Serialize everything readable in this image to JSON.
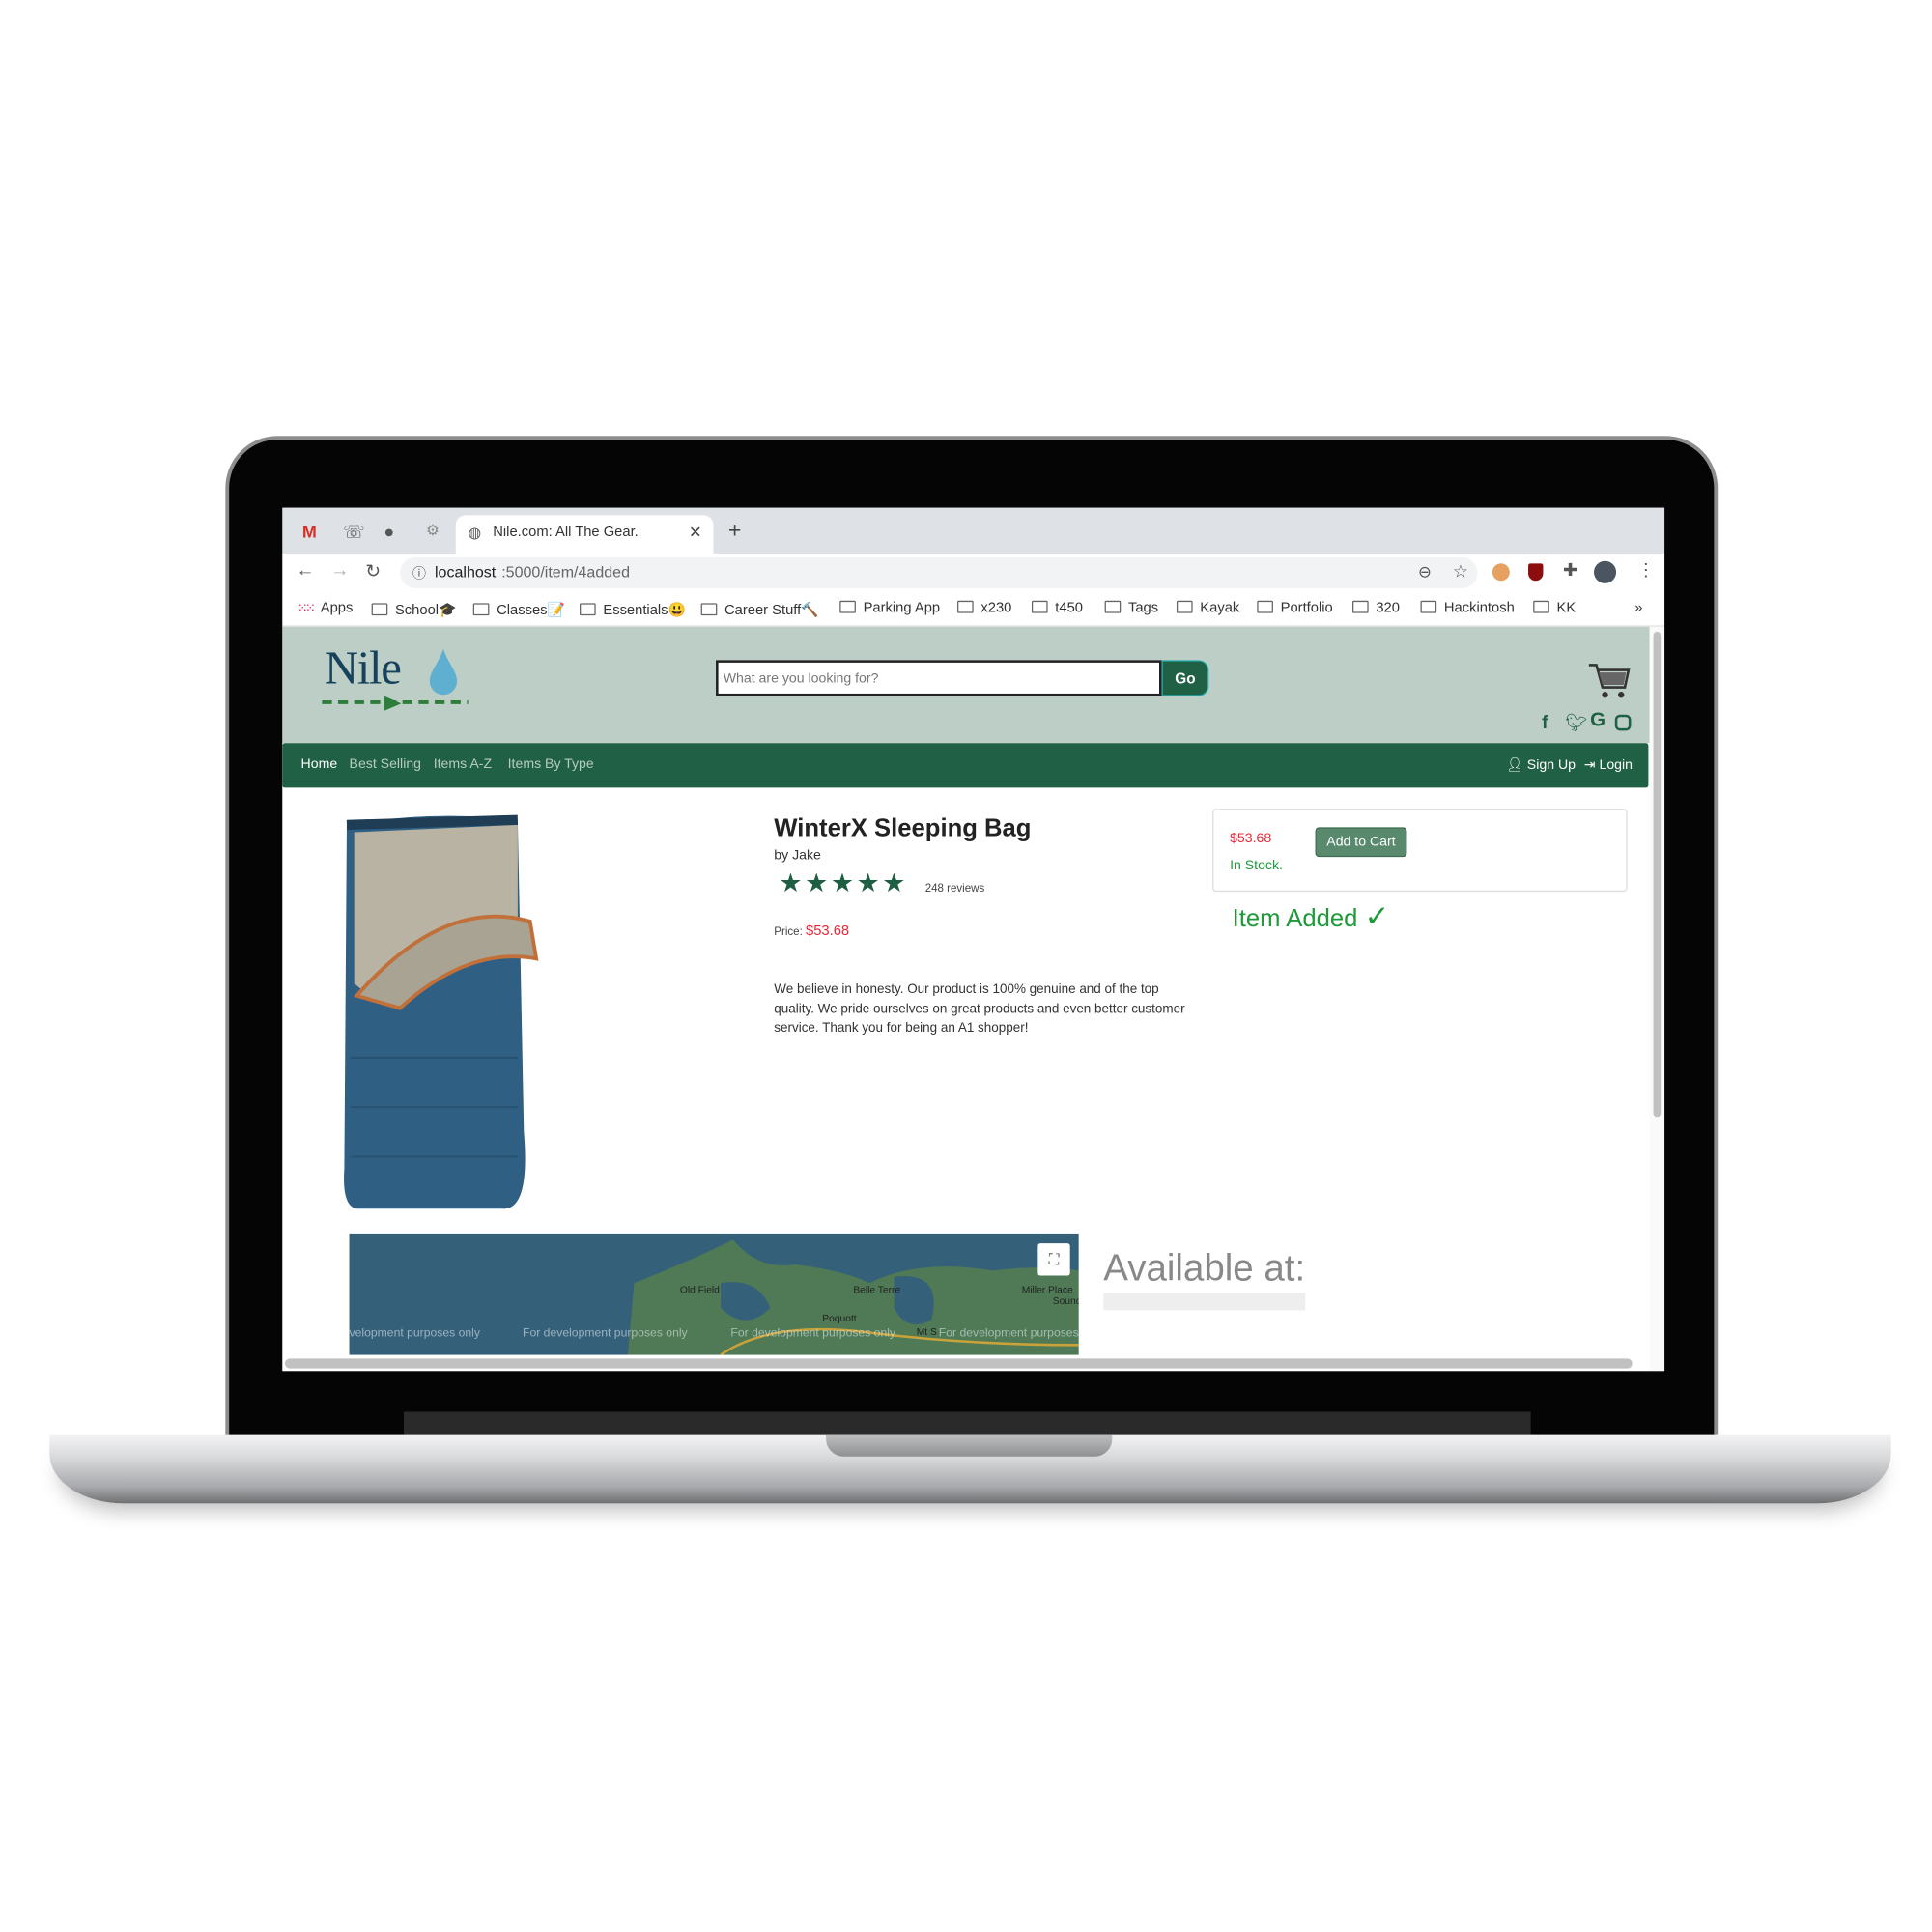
{
  "browser": {
    "tab_title": "Nile.com: All The Gear.",
    "url_host": "localhost",
    "url_path": ":5000/item/4added",
    "bookmarks": [
      "Apps",
      "School🎓",
      "Classes📝",
      "Essentials😃",
      "Career Stuff🔨",
      "Parking App",
      "x230",
      "t450",
      "Tags",
      "Kayak",
      "Portfolio",
      "320",
      "Hackintosh",
      "KK"
    ],
    "more": "»"
  },
  "site": {
    "logo_text": "Nile",
    "search_placeholder": "What are you looking for?",
    "search_button": "Go",
    "nav": [
      "Home",
      "Best Selling",
      "Items A-Z",
      "Items By Type"
    ],
    "signup": "Sign Up",
    "login": "Login",
    "social_icons": [
      "facebook-icon",
      "twitter-icon",
      "google-icon",
      "instagram-icon"
    ]
  },
  "product": {
    "title": "WinterX Sleeping Bag",
    "author": "by Jake",
    "rating": 5,
    "reviews": "248 reviews",
    "price_label": "Price:",
    "price": "$53.68",
    "description": "We believe in honesty. Our product is 100% genuine and of the top quality. We pride ourselves on great products and even better customer service. Thank you for being an A1 shopper!",
    "box_price": "$53.68",
    "add_to_cart": "Add to Cart",
    "stock": "In Stock.",
    "added_message": "Item Added",
    "added_check": "✓"
  },
  "map": {
    "watermark": "For development purposes only",
    "watermark_cut": "velopment purposes only",
    "places": [
      "Old Field",
      "Belle Terre",
      "Miller Place",
      "Poquott",
      "Sound",
      "Mt S"
    ],
    "available_heading": "Available at:"
  },
  "colors": {
    "brand_green": "#206044",
    "header_bg": "#bccec5",
    "price_red": "#e8283a",
    "added_green": "#1e9a3a"
  }
}
